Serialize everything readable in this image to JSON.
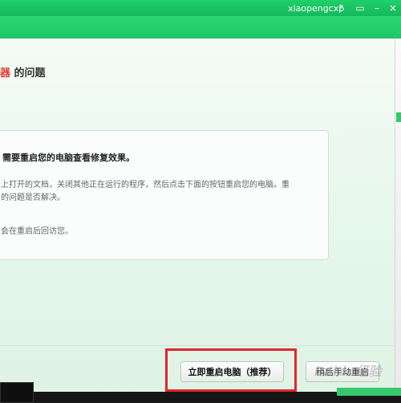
{
  "titlebar": {
    "username": "xiaopengcxp",
    "caret": "▾",
    "icons": [
      "message-icon",
      "minimize-icon",
      "close-icon"
    ]
  },
  "heading": {
    "red_fragment": "器",
    "text": " 的问题"
  },
  "card": {
    "title": "需要重启您的电脑查看修复效果。",
    "line1": "上打开的文档，关闭其他正在运行的程序，然后点击下面的按钮重启您的电脑。重",
    "line2": "的问题是否解决。",
    "line3": "会在重启后回访您。"
  },
  "buttons": {
    "restart_now": "立即重启电脑（推荐）",
    "later": "稍后手动重启"
  },
  "watermark": "Baidu经验",
  "colors": {
    "titlebar": "#1fd06a",
    "highlight": "#e0252f",
    "accent_red": "#e03c2f"
  }
}
